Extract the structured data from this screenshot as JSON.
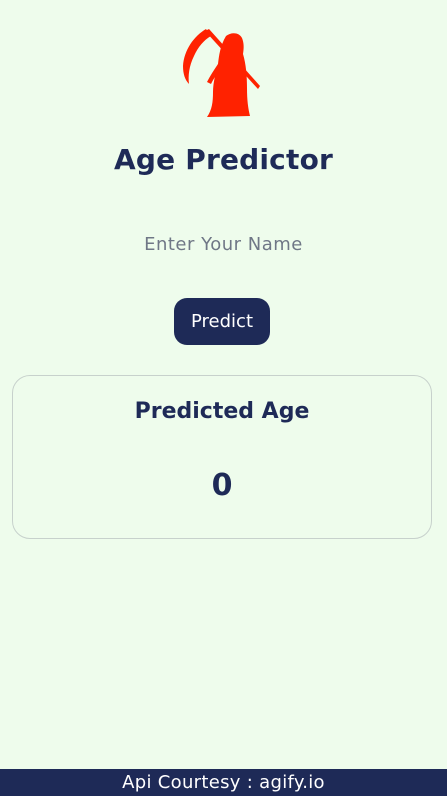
{
  "header": {
    "logo_icon": "grim-reaper-icon",
    "title": "Age Predictor"
  },
  "form": {
    "name_placeholder": "Enter Your Name",
    "name_value": "",
    "predict_label": "Predict"
  },
  "result": {
    "title": "Predicted Age",
    "age": "0"
  },
  "footer": {
    "text": "Api Courtesy : agify.io"
  },
  "colors": {
    "background": "#eefcec",
    "primary": "#1e2a57",
    "logo": "#ff2200"
  }
}
